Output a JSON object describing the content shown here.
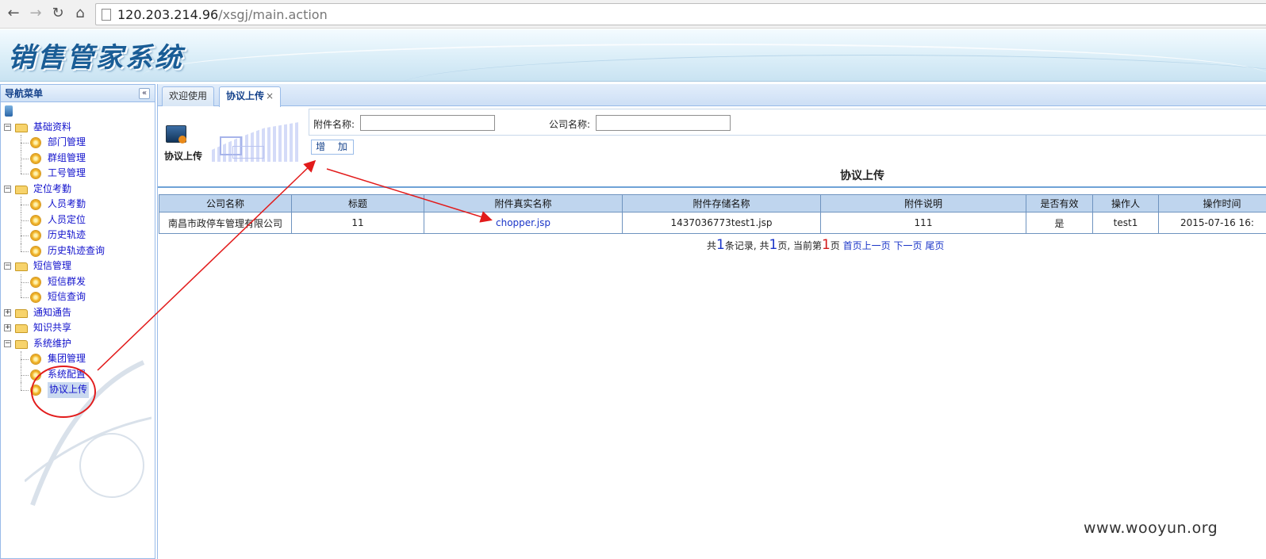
{
  "browser": {
    "url_host": "120.203.214.96",
    "url_path": "/xsgj/main.action"
  },
  "header": {
    "title": "销售管家系统"
  },
  "nav": {
    "title": "导航菜单",
    "collapse": "«",
    "groups": [
      {
        "label": "基础资料",
        "toggle": "−",
        "items": [
          "部门管理",
          "群组管理",
          "工号管理"
        ]
      },
      {
        "label": "定位考勤",
        "toggle": "−",
        "items": [
          "人员考勤",
          "人员定位",
          "历史轨迹",
          "历史轨迹查询"
        ]
      },
      {
        "label": "短信管理",
        "toggle": "−",
        "items": [
          "短信群发",
          "短信查询"
        ]
      },
      {
        "label": "通知通告",
        "toggle": "+",
        "items": []
      },
      {
        "label": "知识共享",
        "toggle": "+",
        "items": []
      },
      {
        "label": "系统维护",
        "toggle": "−",
        "items": [
          "集团管理",
          "系统配置",
          "协议上传"
        ]
      }
    ]
  },
  "tabs": [
    {
      "label": "欢迎使用"
    },
    {
      "label": "协议上传",
      "close": "×"
    }
  ],
  "page": {
    "logo_caption": "协议上传",
    "search": {
      "attachment_label": "附件名称:",
      "company_label": "公司名称:",
      "attachment_value": "",
      "company_value": ""
    },
    "add_button": "增 加",
    "section_title": "协议上传"
  },
  "table": {
    "columns": [
      "公司名称",
      "标题",
      "附件真实名称",
      "附件存储名称",
      "附件说明",
      "是否有效",
      "操作人",
      "操作时间"
    ],
    "rows": [
      [
        "南昌市政停车管理有限公司",
        "11",
        "chopper.jsp",
        "1437036773test1.jsp",
        "111",
        "是",
        "test1",
        "2015-07-16 16:"
      ]
    ]
  },
  "pager": {
    "prefix": "共",
    "records": "1",
    "records_suffix": "条记录, 共",
    "pages": "1",
    "pages_suffix": "页, 当前第",
    "current": "1",
    "current_suffix": "页",
    "first": "首页",
    "prev": "上一页",
    "next": "下一页",
    "last": "尾页"
  },
  "watermark": "www.wooyun.org",
  "colors": {
    "annotation": "#e21b1b",
    "link": "#1a35c8",
    "header_blue": "#1a5d96"
  },
  "icons": {
    "back": "back-arrow-icon",
    "forward": "forward-arrow-icon",
    "reload": "reload-icon",
    "home": "home-icon"
  }
}
